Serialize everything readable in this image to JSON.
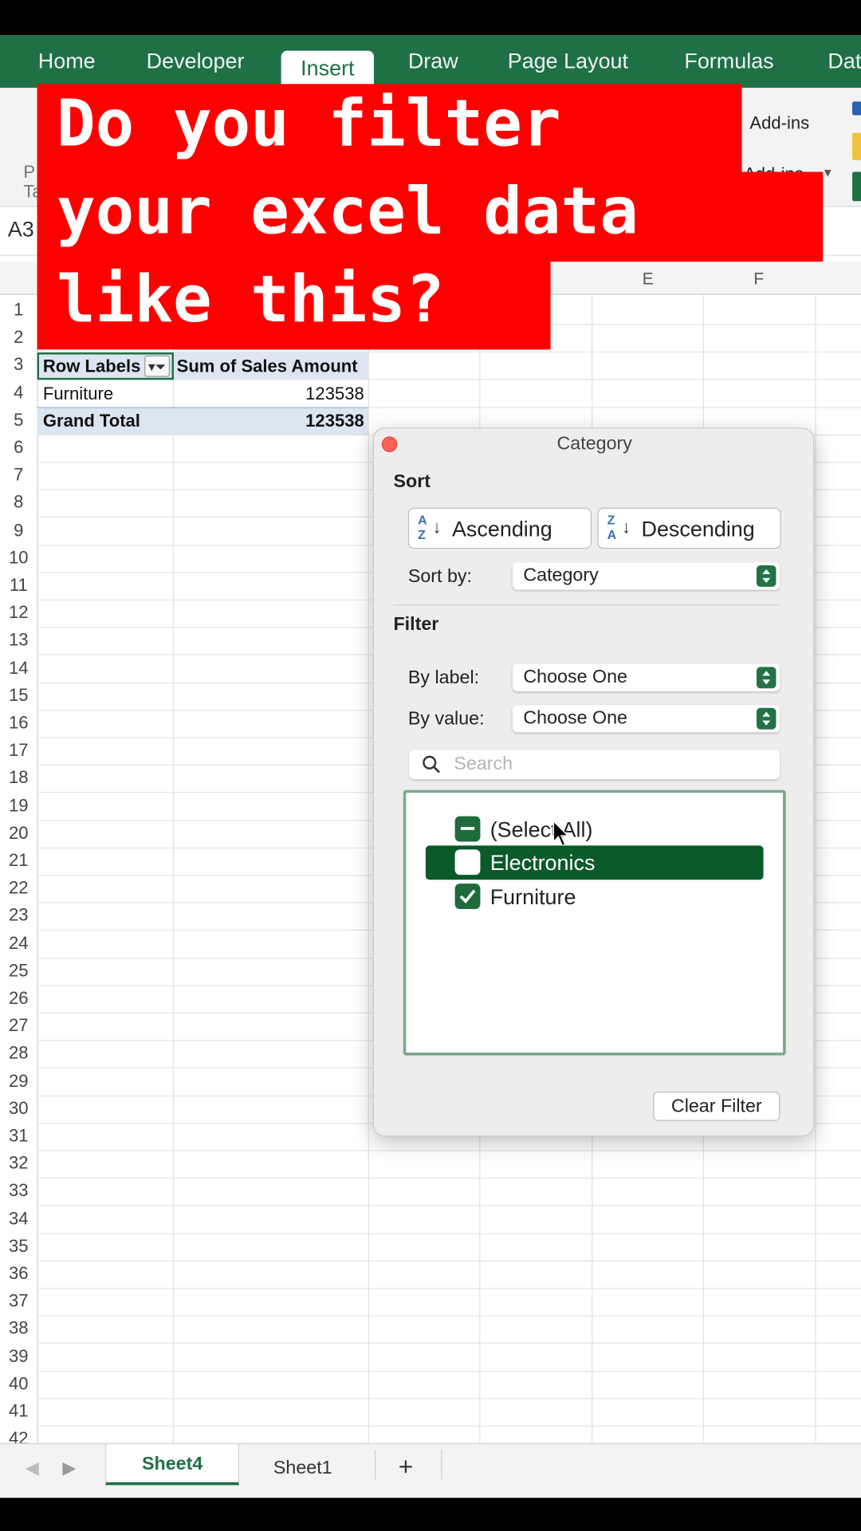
{
  "ribbon": {
    "tabs": [
      "Home",
      "Developer",
      "Insert",
      "Draw",
      "Page Layout",
      "Formulas",
      "Dat"
    ],
    "addins": "Add-ins",
    "addins2": "Add-ins",
    "left_labels": [
      "P",
      "Ta"
    ]
  },
  "name_box": "A3",
  "columns": [
    "E",
    "F"
  ],
  "rows": [
    "1",
    "2",
    "3",
    "4",
    "5",
    "6",
    "7",
    "8",
    "9",
    "10",
    "11",
    "12",
    "13",
    "14",
    "15",
    "16",
    "17",
    "18",
    "19",
    "20",
    "21",
    "22",
    "23",
    "24",
    "25",
    "26",
    "27",
    "28",
    "29",
    "30",
    "31",
    "32",
    "33",
    "34",
    "35",
    "36",
    "37",
    "38",
    "39",
    "40",
    "41",
    "42"
  ],
  "pivot": {
    "header_label": "Row Labels",
    "header_value": "Sum of Sales Amount",
    "row_label": "Furniture",
    "row_value": "123538",
    "total_label": "Grand Total",
    "total_value": "123538"
  },
  "banner": {
    "line1": "Do you filter",
    "line2": "your excel data",
    "line3": "like this?"
  },
  "dialog": {
    "title": "Category",
    "sort_heading": "Sort",
    "ascending": "Ascending",
    "descending": "Descending",
    "sort_by_label": "Sort by:",
    "sort_by_value": "Category",
    "filter_heading": "Filter",
    "by_label_label": "By label:",
    "by_label_value": "Choose One",
    "by_value_label": "By value:",
    "by_value_value": "Choose One",
    "search_placeholder": "Search",
    "items": [
      {
        "label": "(Select All)",
        "state": "mixed"
      },
      {
        "label": "Electronics",
        "state": "unchecked"
      },
      {
        "label": "Furniture",
        "state": "checked"
      }
    ],
    "clear_filter": "Clear Filter"
  },
  "sheets": {
    "active": "Sheet4",
    "other": "Sheet1",
    "add": "+"
  },
  "colors": {
    "excel_green": "#1e7145",
    "banner_red": "#ff0000",
    "pivot_header_bg": "#dce6f1",
    "selected_item_bg": "#0b5a2a"
  }
}
